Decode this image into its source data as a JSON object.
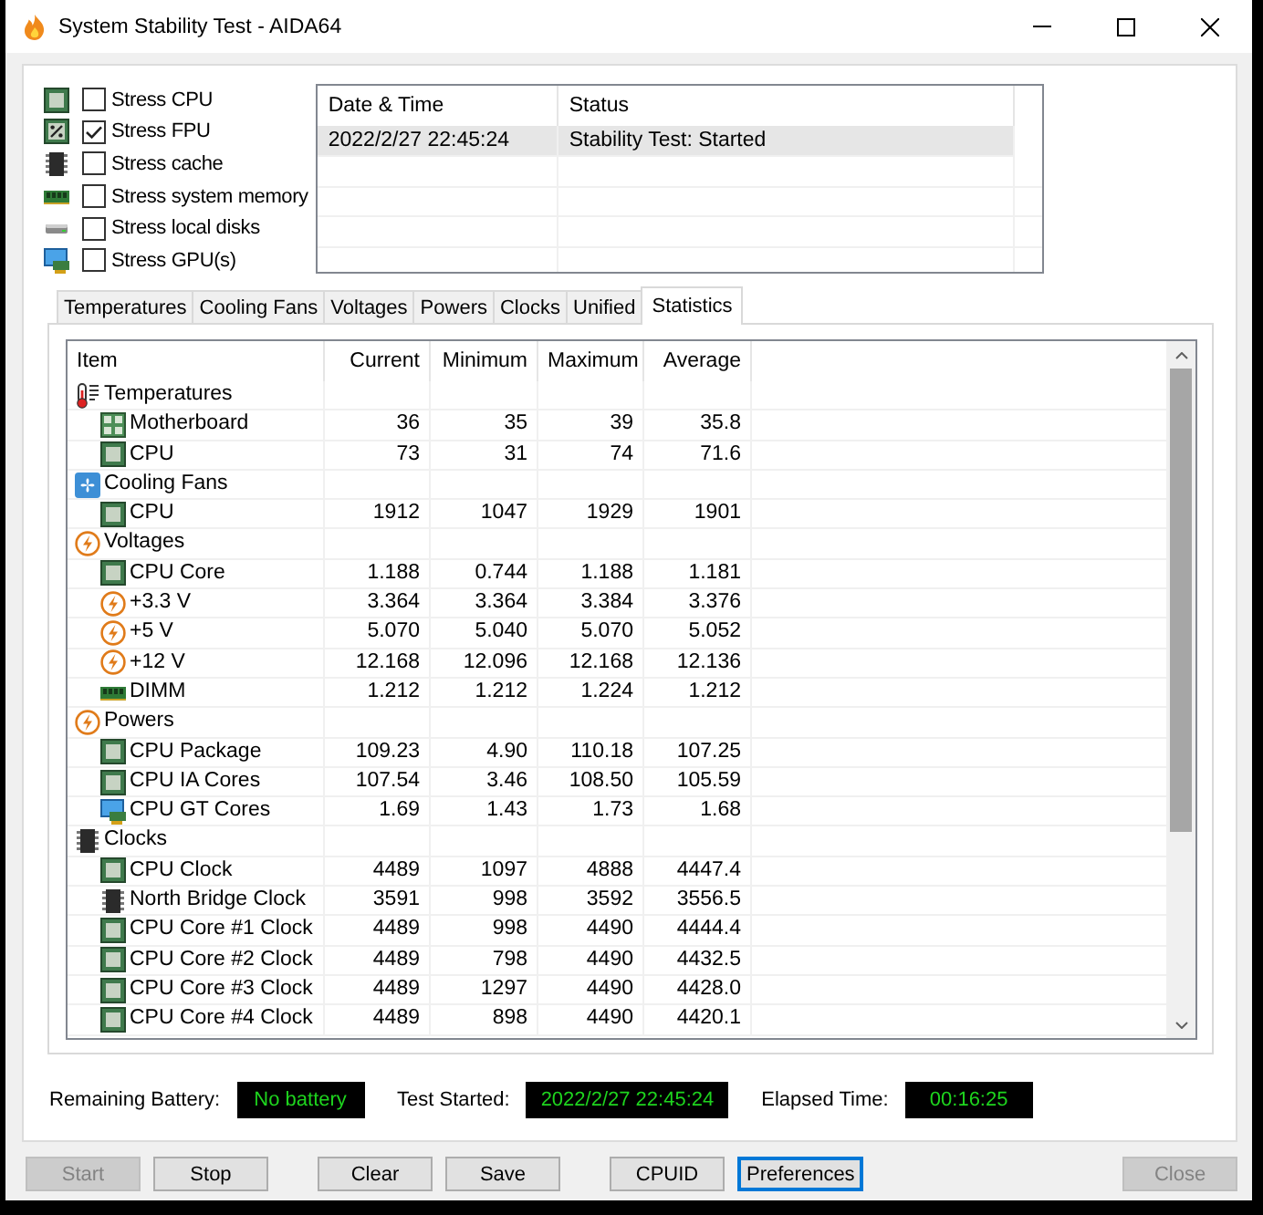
{
  "window": {
    "title": "System Stability Test - AIDA64"
  },
  "stress_options": [
    {
      "kind": "cpu",
      "label": "Stress CPU",
      "checked": false
    },
    {
      "kind": "fpu",
      "label": "Stress FPU",
      "checked": true
    },
    {
      "kind": "chip",
      "label": "Stress cache",
      "checked": false
    },
    {
      "kind": "memory",
      "label": "Stress system memory",
      "checked": false
    },
    {
      "kind": "disk",
      "label": "Stress local disks",
      "checked": false
    },
    {
      "kind": "gpu",
      "label": "Stress GPU(s)",
      "checked": false
    }
  ],
  "log": {
    "columns": [
      "Date & Time",
      "Status"
    ],
    "rows": [
      {
        "cells": [
          "2022/2/27 22:45:24",
          "Stability Test: Started"
        ],
        "selected": true
      }
    ]
  },
  "tabs": [
    {
      "label": "Temperatures",
      "selected": false
    },
    {
      "label": "Cooling Fans",
      "selected": false
    },
    {
      "label": "Voltages",
      "selected": false
    },
    {
      "label": "Powers",
      "selected": false
    },
    {
      "label": "Clocks",
      "selected": false
    },
    {
      "label": "Unified",
      "selected": false
    },
    {
      "label": "Statistics",
      "selected": true
    }
  ],
  "statistics": {
    "columns": [
      "Item",
      "Current",
      "Minimum",
      "Maximum",
      "Average"
    ],
    "rows": [
      {
        "kind": "thermometer",
        "label": "Temperatures",
        "children": [
          {
            "kind": "board",
            "label": "Motherboard",
            "values": [
              "36",
              "35",
              "39",
              "35.8"
            ]
          },
          {
            "kind": "cpu",
            "label": "CPU",
            "values": [
              "73",
              "31",
              "74",
              "71.6"
            ]
          }
        ]
      },
      {
        "kind": "fan",
        "label": "Cooling Fans",
        "children": [
          {
            "kind": "cpu",
            "label": "CPU",
            "values": [
              "1912",
              "1047",
              "1929",
              "1901"
            ]
          }
        ]
      },
      {
        "kind": "bolt",
        "label": "Voltages",
        "children": [
          {
            "kind": "cpu",
            "label": "CPU Core",
            "values": [
              "1.188",
              "0.744",
              "1.188",
              "1.181"
            ]
          },
          {
            "kind": "bolt",
            "label": "+3.3 V",
            "values": [
              "3.364",
              "3.364",
              "3.384",
              "3.376"
            ]
          },
          {
            "kind": "bolt",
            "label": "+5 V",
            "values": [
              "5.070",
              "5.040",
              "5.070",
              "5.052"
            ]
          },
          {
            "kind": "bolt",
            "label": "+12 V",
            "values": [
              "12.168",
              "12.096",
              "12.168",
              "12.136"
            ]
          },
          {
            "kind": "memory",
            "label": "DIMM",
            "values": [
              "1.212",
              "1.212",
              "1.224",
              "1.212"
            ]
          }
        ]
      },
      {
        "kind": "bolt",
        "label": "Powers",
        "children": [
          {
            "kind": "cpu",
            "label": "CPU Package",
            "values": [
              "109.23",
              "4.90",
              "110.18",
              "107.25"
            ]
          },
          {
            "kind": "cpu",
            "label": "CPU IA Cores",
            "values": [
              "107.54",
              "3.46",
              "108.50",
              "105.59"
            ]
          },
          {
            "kind": "gpu",
            "label": "CPU GT Cores",
            "values": [
              "1.69",
              "1.43",
              "1.73",
              "1.68"
            ]
          }
        ]
      },
      {
        "kind": "chip",
        "label": "Clocks",
        "children": [
          {
            "kind": "cpu",
            "label": "CPU Clock",
            "values": [
              "4489",
              "1097",
              "4888",
              "4447.4"
            ]
          },
          {
            "kind": "chip",
            "label": "North Bridge Clock",
            "values": [
              "3591",
              "998",
              "3592",
              "3556.5"
            ]
          },
          {
            "kind": "cpu",
            "label": "CPU Core #1 Clock",
            "values": [
              "4489",
              "998",
              "4490",
              "4444.4"
            ]
          },
          {
            "kind": "cpu",
            "label": "CPU Core #2 Clock",
            "values": [
              "4489",
              "798",
              "4490",
              "4432.5"
            ]
          },
          {
            "kind": "cpu",
            "label": "CPU Core #3 Clock",
            "values": [
              "4489",
              "1297",
              "4490",
              "4428.0"
            ]
          },
          {
            "kind": "cpu",
            "label": "CPU Core #4 Clock",
            "values": [
              "4489",
              "898",
              "4490",
              "4420.1"
            ]
          }
        ]
      }
    ]
  },
  "status": [
    {
      "label": "Remaining Battery:",
      "value": "No battery"
    },
    {
      "label": "Test Started:",
      "value": "2022/2/27 22:45:24"
    },
    {
      "label": "Elapsed Time:",
      "value": "00:16:25"
    }
  ],
  "buttons": [
    [
      {
        "label": "Start",
        "disabled": true,
        "focused": false
      },
      {
        "label": "Stop",
        "disabled": false,
        "focused": false
      }
    ],
    [
      {
        "label": "Clear",
        "disabled": false,
        "focused": false
      },
      {
        "label": "Save",
        "disabled": false,
        "focused": false
      }
    ],
    [
      {
        "label": "CPUID",
        "disabled": false,
        "focused": false
      },
      {
        "label": "Preferences",
        "disabled": false,
        "focused": true
      }
    ],
    [
      {
        "label": "Close",
        "disabled": true,
        "focused": false
      }
    ]
  ]
}
